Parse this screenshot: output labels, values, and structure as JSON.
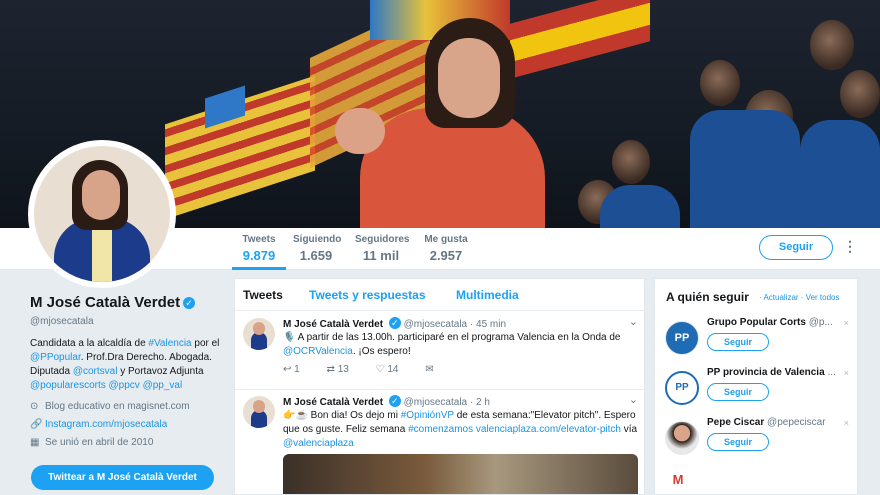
{
  "header": {
    "stats": [
      {
        "label": "Tweets",
        "value": "9.879"
      },
      {
        "label": "Siguiendo",
        "value": "1.659"
      },
      {
        "label": "Seguidores",
        "value": "11 mil"
      },
      {
        "label": "Me gusta",
        "value": "2.957"
      }
    ],
    "follow_label": "Seguir",
    "more_label": "⋮"
  },
  "profile": {
    "name": "M José Català Verdet",
    "handle": "@mjosecatala",
    "bio": [
      {
        "t": "Candidata a la alcaldía de ",
        "link": false
      },
      {
        "t": "#Valencia",
        "link": true
      },
      {
        "t": " por el ",
        "link": false
      },
      {
        "t": "@PPopular",
        "link": true
      },
      {
        "t": ". Prof.Dra Derecho. Abogada. Diputada ",
        "link": false
      },
      {
        "t": "@cortsval",
        "link": true
      },
      {
        "t": " y Portavoz Adjunta ",
        "link": false
      },
      {
        "t": "@popularescorts",
        "link": true
      },
      {
        "t": " ",
        "link": false
      },
      {
        "t": "@ppcv",
        "link": true
      },
      {
        "t": " ",
        "link": false
      },
      {
        "t": "@pp_val",
        "link": true
      }
    ],
    "location": "Blog educativo en magisnet.com",
    "url": "Instagram.com/mjosecatala",
    "joined": "Se unió en abril de 2010",
    "tweet_to_label": "Twittear a M José Català Verdet"
  },
  "timeline": {
    "tabs": [
      "Tweets",
      "Tweets y respuestas",
      "Multimedia"
    ],
    "tweets": [
      {
        "name": "M José Català Verdet",
        "handle": "@mjosecatala · 45 min",
        "text_parts": [
          {
            "t": "🎙️ A partir de las 13.00h. participaré en el programa Valencia en la Onda de ",
            "link": false
          },
          {
            "t": "@OCRValencia",
            "link": true
          },
          {
            "t": ". ¡Os espero!",
            "link": false
          }
        ],
        "actions": [
          "1",
          "13",
          "14",
          ""
        ]
      },
      {
        "name": "M José Català Verdet",
        "handle": "@mjosecatala · 2 h",
        "text_parts": [
          {
            "t": "👉☕ Bon dia! Os dejo mi ",
            "link": false
          },
          {
            "t": "#OpiniónVP",
            "link": true
          },
          {
            "t": " de esta semana:\"Elevator pitch\". Espero que os guste. Feliz semana ",
            "link": false
          },
          {
            "t": "#comenzamos",
            "link": true
          },
          {
            "t": " ",
            "link": false
          },
          {
            "t": "valenciaplaza.com/elevator-pitch",
            "link": true
          },
          {
            "t": " vía ",
            "link": false
          },
          {
            "t": "@valenciaplaza",
            "link": true
          }
        ],
        "actions": []
      }
    ]
  },
  "who_to_follow": {
    "title": "A quién seguir",
    "links": "· Actualizar · Ver todos",
    "suggestions": [
      {
        "name": "Grupo Popular Corts",
        "handle": "@p...",
        "avatar": "PP",
        "button": "Seguir"
      },
      {
        "name": "PP provincia de Valencia",
        "handle": "...",
        "avatar": "PP",
        "button": "Seguir"
      },
      {
        "name": "Pepe Ciscar",
        "handle": "@pepeciscar",
        "avatar": "person",
        "button": "Seguir"
      }
    ],
    "close_label": "×"
  },
  "icons": {
    "verified": "verified-check-icon",
    "location": "location-pin-icon",
    "link": "link-icon",
    "calendar": "calendar-icon",
    "reply": "reply-icon",
    "retweet": "retweet-icon",
    "like": "heart-icon",
    "dm": "envelope-icon",
    "gmail": "gmail-icon"
  },
  "colors": {
    "accent": "#1da1f2",
    "link": "#1b95e0",
    "pp_blue": "#1f6cb5"
  }
}
